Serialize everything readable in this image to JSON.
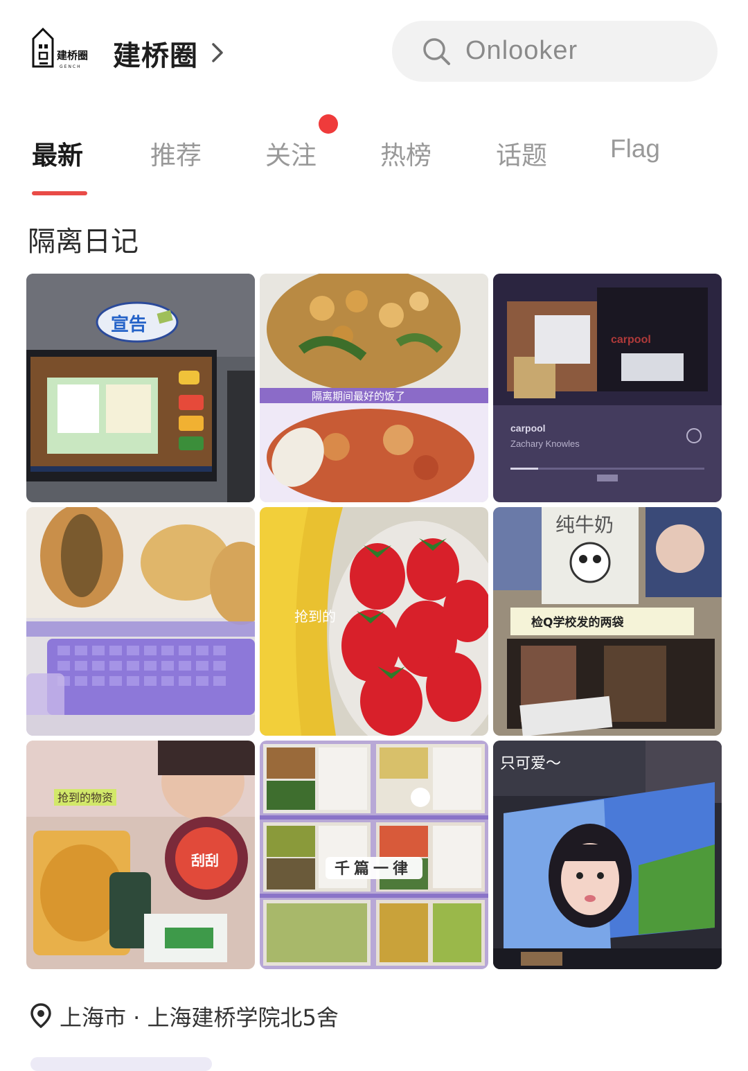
{
  "header": {
    "logo_text": "建桥圈",
    "logo_subtext": "GENCH",
    "circle_name": "建桥圈",
    "search_placeholder": "Onlooker"
  },
  "tabs": [
    {
      "label": "最新",
      "active": true
    },
    {
      "label": "推荐",
      "active": false
    },
    {
      "label": "关注",
      "active": false,
      "badge": true
    },
    {
      "label": "热榜",
      "active": false
    },
    {
      "label": "话题",
      "active": false
    },
    {
      "label": "Flag",
      "active": false
    }
  ],
  "post": {
    "title": "隔离日记",
    "images": [
      {
        "name": "announcement-monopoly-game",
        "caption": "宣告"
      },
      {
        "name": "best-meal-during-quarantine",
        "caption": "隔离期间最好的饭了"
      },
      {
        "name": "carpool-music-player",
        "caption": "carpool",
        "song": "carpool",
        "artist": "Zachary Knowles"
      },
      {
        "name": "bread-and-purple-keyboard",
        "caption": ""
      },
      {
        "name": "strawberries-bananas",
        "caption": "抢到的"
      },
      {
        "name": "milk-and-tv",
        "caption": "检Q学校发的两袋",
        "text": "纯牛奶"
      },
      {
        "name": "snacks-haul",
        "caption": "抢到的物资"
      },
      {
        "name": "meal-boxes-collage",
        "caption": "千篇一律"
      },
      {
        "name": "cute-girl-screen",
        "caption": "只可爱～"
      }
    ],
    "location": "上海市 · 上海建桥学院北5舍"
  },
  "colors": {
    "accent": "#e94b47",
    "badge": "#ef3b3b",
    "search_bg": "#f2f2f2"
  }
}
